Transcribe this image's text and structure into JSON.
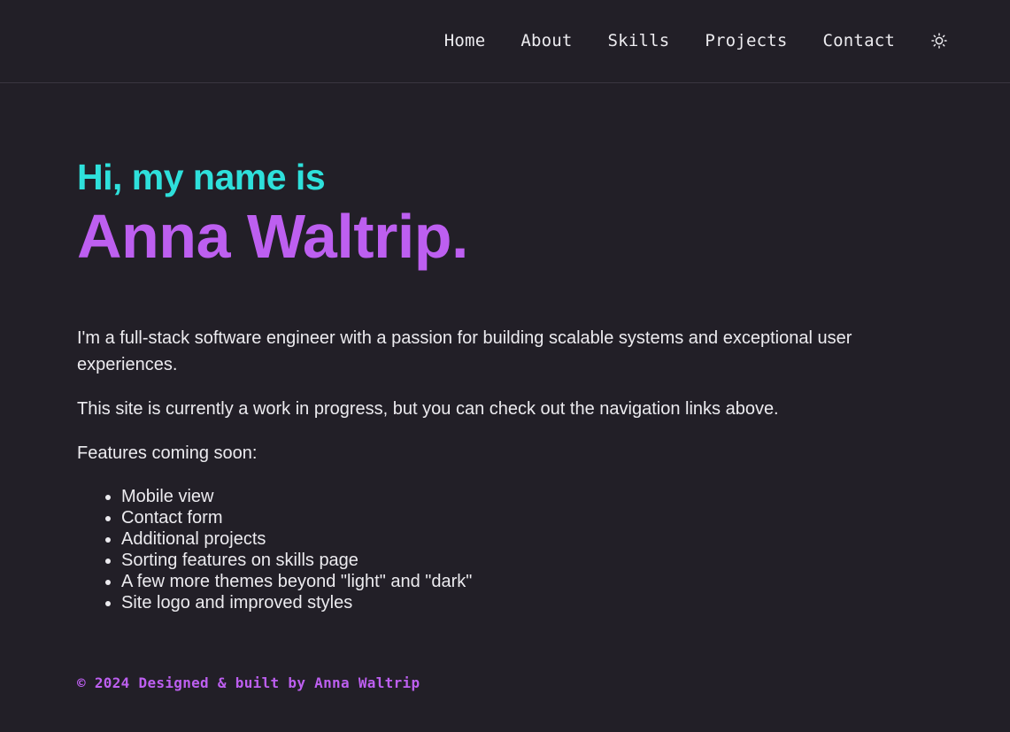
{
  "nav": {
    "items": [
      {
        "label": "Home"
      },
      {
        "label": "About"
      },
      {
        "label": "Skills"
      },
      {
        "label": "Projects"
      },
      {
        "label": "Contact"
      }
    ],
    "theme_toggle_icon": "sun-icon"
  },
  "hero": {
    "greeting": "Hi, my name is",
    "name": "Anna Waltrip."
  },
  "intro": {
    "paragraph1": "I'm a full-stack software engineer with a passion for building scalable systems and exceptional user experiences.",
    "paragraph2": "This site is currently a work in progress, but you can check out the navigation links above.",
    "features_heading": "Features coming soon:",
    "features": [
      "Mobile view",
      "Contact form",
      "Additional projects",
      "Sorting features on skills page",
      "A few more themes beyond \"light\" and \"dark\"",
      "Site logo and improved styles"
    ]
  },
  "footer": {
    "text": "© 2024 Designed & built by Anna Waltrip"
  },
  "colors": {
    "background": "#221f27",
    "accent_cyan": "#2ee0db",
    "accent_purple": "#bd5ff0",
    "text": "#ecebef"
  }
}
